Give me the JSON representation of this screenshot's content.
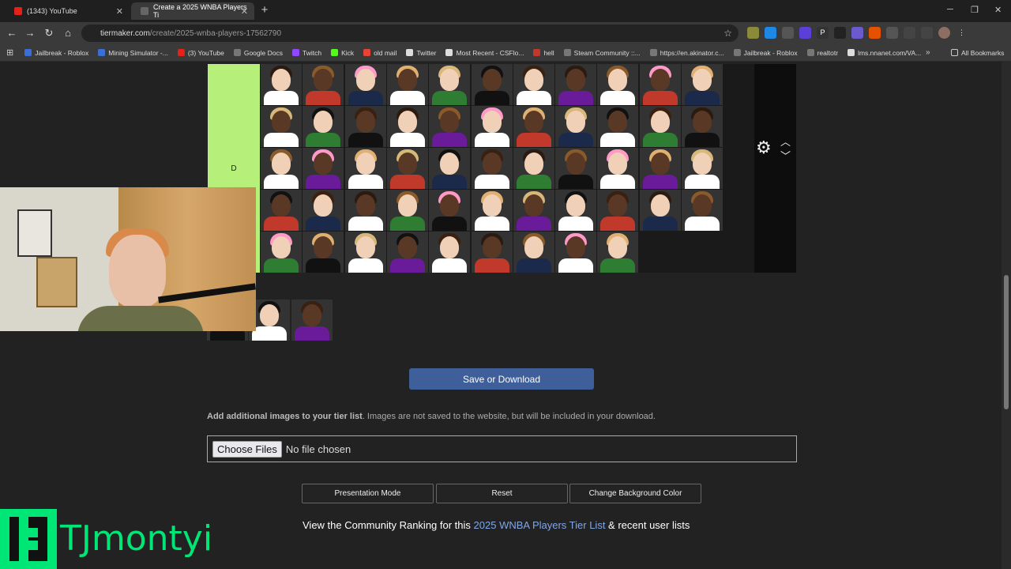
{
  "browser": {
    "tabs": [
      {
        "title": "(1343) YouTube",
        "fav": "#e62117",
        "active": false
      },
      {
        "title": "Create a 2025 WNBA Players Ti",
        "fav": "#444444",
        "active": true
      }
    ],
    "url_host": "tiermaker.com",
    "url_path": "/create/2025-wnba-players-17562790",
    "bookmarks": [
      {
        "label": "Jailbreak - Roblox",
        "color": "#3b6fd8"
      },
      {
        "label": "Mining Simulator -...",
        "color": "#3b6fd8"
      },
      {
        "label": "(3) YouTube",
        "color": "#e62117"
      },
      {
        "label": "Google Docs",
        "color": "#777777"
      },
      {
        "label": "Twitch",
        "color": "#9146ff"
      },
      {
        "label": "Kick",
        "color": "#53fc18"
      },
      {
        "label": "old mail",
        "color": "#ea4335"
      },
      {
        "label": "Twitter",
        "color": "#dddddd"
      },
      {
        "label": "Most Recent - CSFlo...",
        "color": "#dddddd"
      },
      {
        "label": "hell",
        "color": "#c0392b"
      },
      {
        "label": "Steam Community ::...",
        "color": "#777777"
      },
      {
        "label": "https://en.akinator.c...",
        "color": "#777777"
      },
      {
        "label": "Jailbreak - Roblox",
        "color": "#777777"
      },
      {
        "label": "realtotr",
        "color": "#777777"
      },
      {
        "label": "lms.nnanet.com/VA...",
        "color": "#dddddd"
      }
    ],
    "all_bookmarks": "All Bookmarks"
  },
  "tier": {
    "label": "D",
    "color": "#b6f07a"
  },
  "save_label": "Save or Download",
  "add_images_bold": "Add additional images to your tier list",
  "add_images_rest": ". Images are not saved to the website, but will be included in your download.",
  "choose_files": "Choose Files",
  "no_file": "No file chosen",
  "buttons": {
    "presentation": "Presentation Mode",
    "reset": "Reset",
    "bg": "Change Background Color"
  },
  "community_pre": "View the Community Ranking for this ",
  "community_link": "2025 WNBA Players Tier List",
  "community_post": " & recent user lists",
  "channel_name": "TJmontyi"
}
